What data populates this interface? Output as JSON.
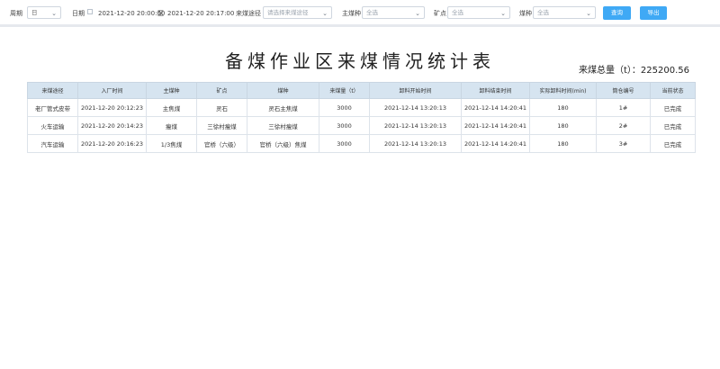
{
  "filters": {
    "period_label": "周期",
    "period_value": "日",
    "date_label": "日期",
    "date_start": "2021-12-20 20:00:00",
    "date_sep": "至",
    "date_end": "2021-12-20 20:17:00",
    "route_label": "来煤途径",
    "route_placeholder": "请选择来煤途径",
    "coal_label": "主煤种",
    "coal_value": "全选",
    "mine_label": "矿点",
    "mine_value": "全选",
    "type_label": "煤种",
    "type_value": "全选",
    "query_label": "查询",
    "export_label": "导出"
  },
  "report": {
    "title": "备煤作业区来煤情况统计表",
    "total": "来煤总量（t）：225200.56"
  },
  "table": {
    "headers": [
      "来煤途径",
      "入厂时间",
      "主煤种",
      "矿点",
      "煤种",
      "来煤量（t）",
      "卸料开始时间",
      "卸料结束时间",
      "实际卸料时间(min)",
      "筒仓编号",
      "当前状态"
    ],
    "rows": [
      [
        "老厂管式皮带",
        "2021-12-20 20:12:23",
        "主焦煤",
        "灵石",
        "灵石主焦煤",
        "3000",
        "2021-12-14 13:20:13",
        "2021-12-14 14:20:41",
        "180",
        "1#",
        "已完成"
      ],
      [
        "火车运输",
        "2021-12-20 20:14:23",
        "瘦煤",
        "三徐村瘦煤",
        "三徐村瘦煤",
        "3000",
        "2021-12-14 13:20:13",
        "2021-12-14 14:20:41",
        "180",
        "2#",
        "已完成"
      ],
      [
        "汽车运输",
        "2021-12-20 20:16:23",
        "1/3焦煤",
        "官桥（六级）",
        "官桥（六级）焦煤",
        "3000",
        "2021-12-14 13:20:13",
        "2021-12-14 14:20:41",
        "180",
        "3#",
        "已完成"
      ]
    ]
  }
}
